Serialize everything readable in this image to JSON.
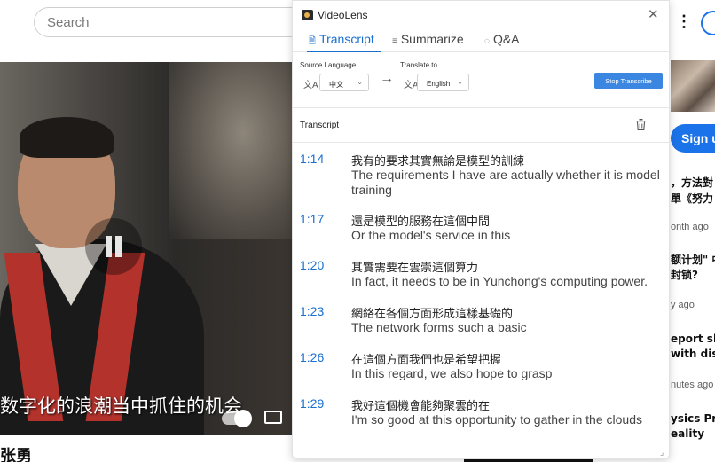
{
  "background": {
    "search_placeholder": "Search",
    "video_subtitle": "数字化的浪潮当中抓住的机会",
    "video_title_fragment": "张勇",
    "signup_label": "Sign up",
    "side_snippets": [
      "，方法對",
      "單《努力",
      "onth ago",
      "额计划\" 中",
      "封锁?",
      "y ago",
      "eport show",
      "with disab",
      "nutes ago",
      "ysics Prin",
      "eality"
    ]
  },
  "panel": {
    "app_title": "VideoLens",
    "tabs": [
      {
        "label": "Transcript",
        "icon": "document-icon",
        "active": true
      },
      {
        "label": "Summarize",
        "icon": "filter-lines-icon",
        "active": false
      },
      {
        "label": "Q&A",
        "icon": "chat-bubble-icon",
        "active": false
      }
    ],
    "source_language_label": "Source Language",
    "source_language_value": "中文",
    "translate_to_label": "Translate to",
    "translate_to_value": "English",
    "stop_button_label": "Stop Transcribe",
    "transcript_heading": "Transcript",
    "accent_color": "#1a6fd1",
    "entries": [
      {
        "time": "1:14",
        "original": "我有的要求其實無論是模型的訓練",
        "translation": "The requirements I have are actually whether it is model training"
      },
      {
        "time": "1:17",
        "original": "還是模型的服務在這個中間",
        "translation": "Or the model's service in this"
      },
      {
        "time": "1:20",
        "original": "其實需要在雲崇這個算力",
        "translation": "In fact, it needs to be in Yunchong's computing power."
      },
      {
        "time": "1:23",
        "original": "網絡在各個方面形成這樣基礎的",
        "translation": "The network forms such a basic"
      },
      {
        "time": "1:26",
        "original": "在這個方面我們也是希望把握",
        "translation": "In this regard, we also hope to grasp"
      },
      {
        "time": "1:29",
        "original": "我好這個機會能夠聚雲的在",
        "translation": "I'm so good at this opportunity to gather in the clouds"
      }
    ]
  }
}
